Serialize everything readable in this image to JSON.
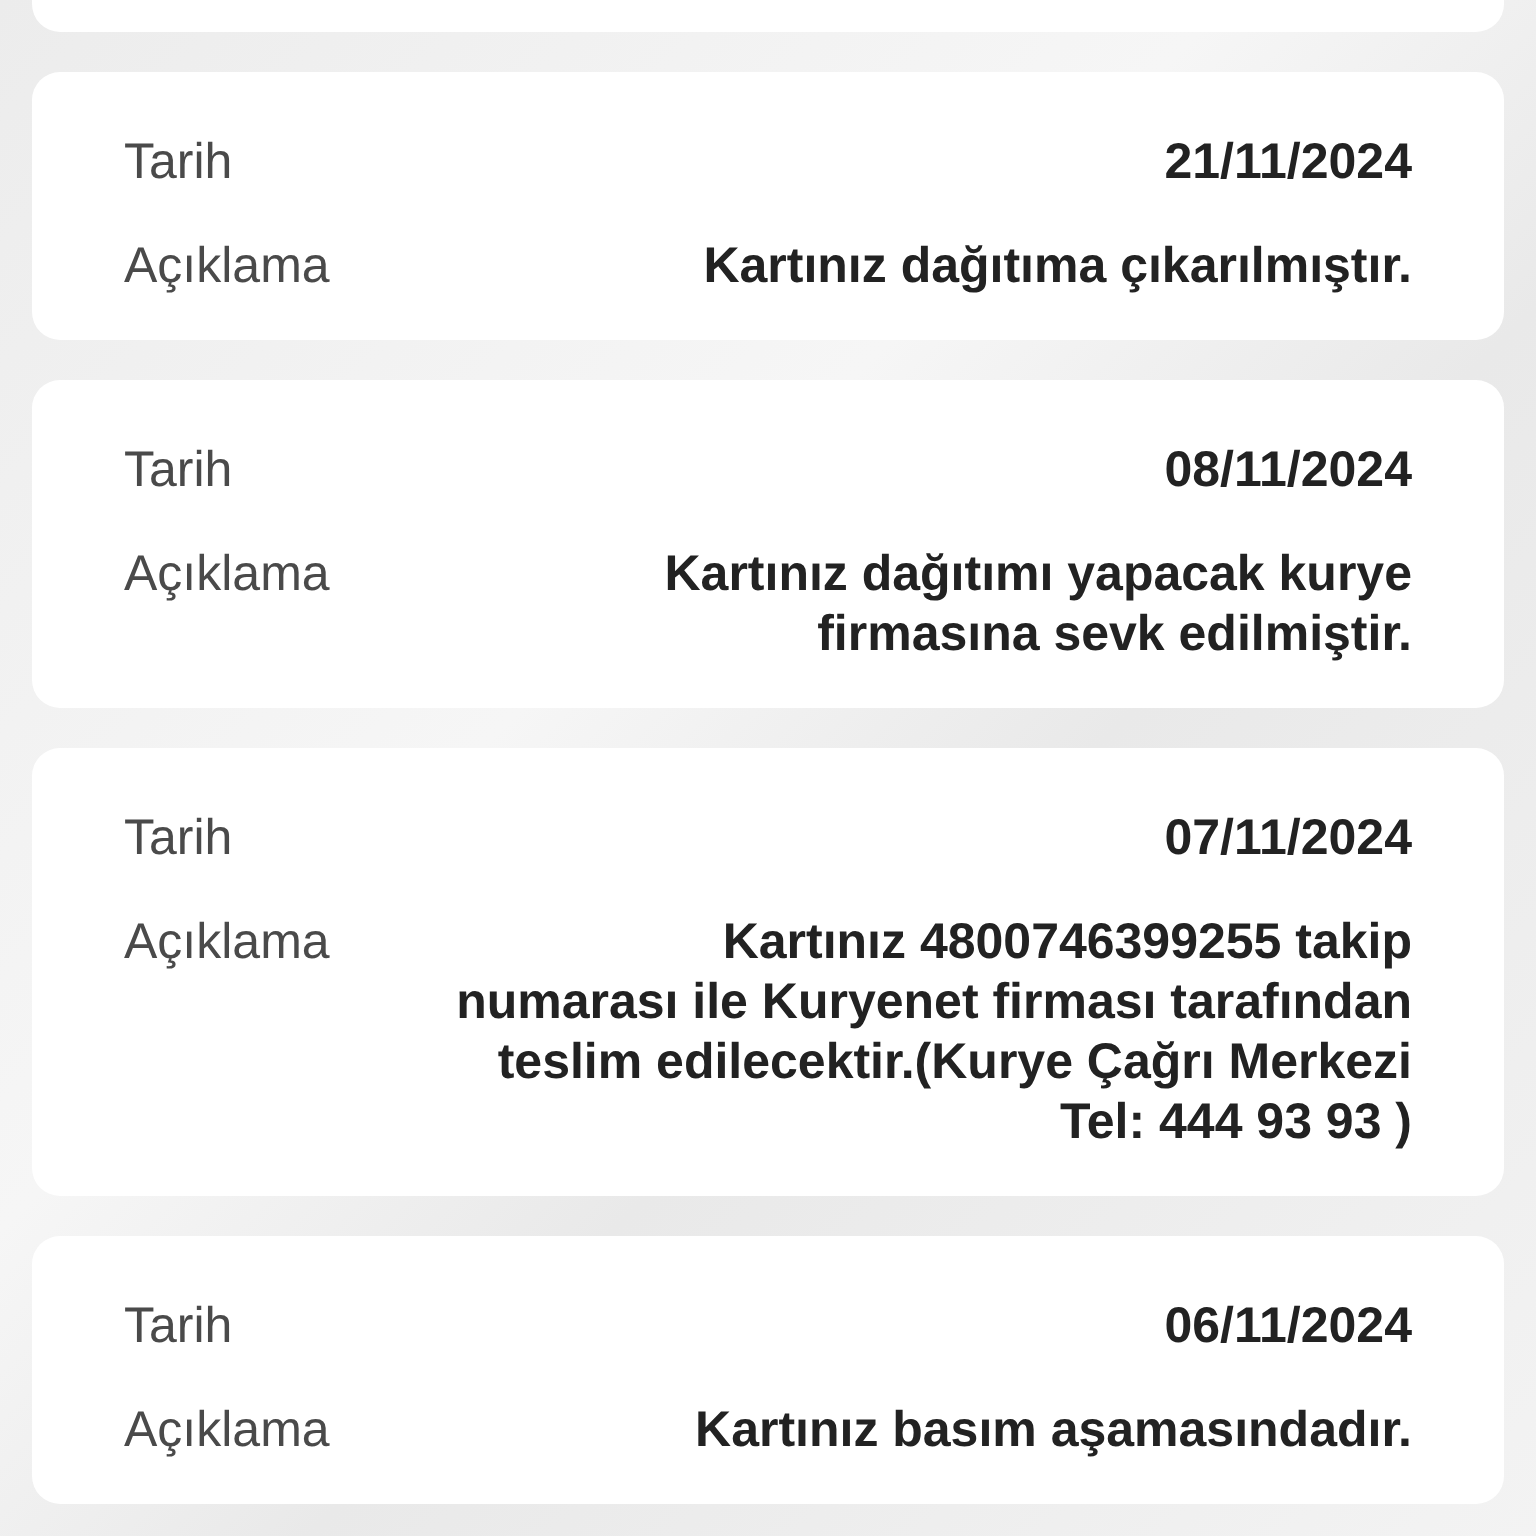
{
  "cards": [
    {
      "date_label": "Tarih",
      "date": "21/11/2024",
      "description_label": "Açıklama",
      "description": "Kartınız dağıtıma çıkarılmıştır."
    },
    {
      "date_label": "Tarih",
      "date": "08/11/2024",
      "description_label": "Açıklama",
      "description": "Kartınız dağıtımı yapacak kurye\nfirmasına sevk edilmiştir."
    },
    {
      "date_label": "Tarih",
      "date": "07/11/2024",
      "description_label": "Açıklama",
      "description": "Kartınız 4800746399255 takip\nnumarası ile Kuryenet firması tarafından\nteslim edilecektir.(Kurye Çağrı Merkezi\nTel: 444 93 93 )"
    },
    {
      "date_label": "Tarih",
      "date": "06/11/2024",
      "description_label": "Açıklama",
      "description": "Kartınız basım aşamasındadır."
    }
  ]
}
